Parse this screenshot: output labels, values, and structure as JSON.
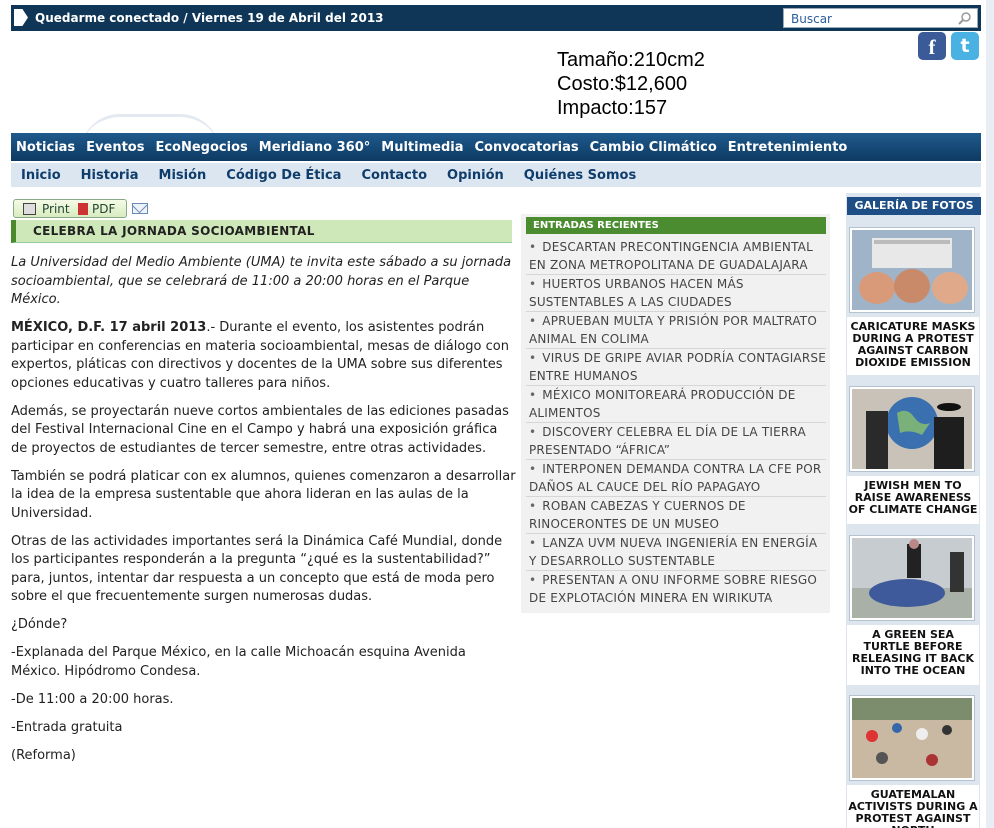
{
  "topbar": {
    "text": "Quedarme conectado  / Viernes 19 de Abril del 2013",
    "search_placeholder": "Buscar"
  },
  "social": {
    "facebook": "f",
    "twitter": "t"
  },
  "stats": {
    "size": "Tamaño:210cm2",
    "cost": "Costo:$12,600",
    "impact": "Impacto:157"
  },
  "main_nav": [
    "Noticias",
    "Eventos",
    "EcoNegocios",
    "Meridiano 360°",
    "Multimedia",
    "Convocatorias",
    "Cambio Climático",
    "Entretenimiento"
  ],
  "sub_nav": [
    "Inicio",
    "Historia",
    "Misión",
    "Código De Ética",
    "Contacto",
    "Opinión",
    "Quiénes Somos"
  ],
  "tools": {
    "print_label": "Print",
    "pdf_label": "PDF"
  },
  "article": {
    "title": "CELEBRA LA JORNADA SOCIOAMBIENTAL",
    "intro": "La Universidad del Medio Ambiente (UMA) te invita este sábado a su jornada socioambiental, que se celebrará de 11:00 a 20:00 horas en el Parque México.",
    "lead_bold": "MÉXICO, D.F. 17 abril 2013",
    "lead_rest": ".- Durante el evento, los asistentes podrán participar en conferencias en materia socioambiental, mesas de diálogo con expertos, pláticas con directivos y docentes de la UMA sobre sus diferentes opciones educativas y cuatro talleres para niños.",
    "p2": "Además, se proyectarán nueve cortos ambientales de las ediciones pasadas del Festival Internacional Cine en el Campo y habrá una exposición gráfica de proyectos de estudiantes de tercer semestre, entre otras actividades.",
    "p3": "También se podrá platicar con ex alumnos, quienes comenzaron a desarrollar la idea de la empresa sustentable que ahora lideran en las aulas de la Universidad.",
    "p4": "Otras de las actividades importantes será la Dinámica Café Mundial, donde los participantes responderán a la pregunta “¿qué es la sustentabilidad?” para, juntos, intentar dar respuesta a un concepto que está de moda pero sobre el que frecuentemente surgen numerosas dudas.",
    "p5": "¿Dónde?",
    "p6": "-Explanada del Parque México, en la calle Michoacán esquina Avenida México. Hipódromo Condesa.",
    "p7": "-De 11:00 a 20:00 horas.",
    "p8": "-Entrada gratuita",
    "p9": "(Reforma)"
  },
  "recent": {
    "heading": "ENTRADAS RECIENTES",
    "items": [
      "DESCARTAN PRECONTINGENCIA AMBIENTAL EN ZONA METROPOLITANA DE GUADALAJARA",
      "HUERTOS URBANOS HACEN MÁS SUSTENTABLES A LAS CIUDADES",
      "APRUEBAN MULTA Y PRISIÓN POR MALTRATO ANIMAL EN COLIMA",
      "VIRUS DE GRIPE AVIAR PODRÍA CONTAGIARSE ENTRE HUMANOS",
      "MÉXICO MONITOREARÁ PRODUCCIÓN DE ALIMENTOS",
      "DISCOVERY CELEBRA EL DÍA DE LA TIERRA PRESENTADO “ÁFRICA”",
      "INTERPONEN DEMANDA CONTRA LA CFE POR DAÑOS AL CAUCE DEL RÍO PAPAGAYO",
      "ROBAN CABEZAS Y CUERNOS DE RINOCERONTES DE UN MUSEO",
      "LANZA UVM NUEVA INGENIERÍA EN ENERGÍA Y DESARROLLO SUSTENTABLE",
      "PRESENTAN A ONU INFORME SOBRE RIESGO DE EXPLOTACIÓN MINERA EN WIRIKUTA"
    ]
  },
  "gallery": {
    "heading": "GALERÍA DE FOTOS",
    "captions": [
      "CARICATURE MASKS DURING A PROTEST AGAINST CARBON DIOXIDE EMISSION",
      "JEWISH MEN TO RAISE AWARENESS OF CLIMATE CHANGE",
      "A GREEN SEA TURTLE BEFORE RELEASING IT BACK INTO THE OCEAN",
      "GUATEMALAN ACTIVISTS DURING A PROTEST AGAINST NORTH"
    ]
  },
  "colors": {
    "topbar": "#0f3657",
    "nav": "#1f5a8c",
    "green_accent": "#4b8c31",
    "gallery_head": "#1d4f86"
  }
}
